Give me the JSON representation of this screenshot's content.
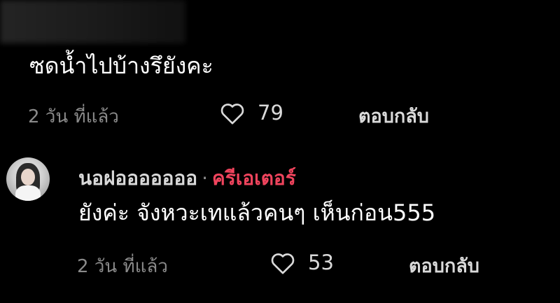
{
  "comment": {
    "text": "ซดน้ำไปบ้างรึยังคะ",
    "time": "2 วัน ที่แล้ว",
    "like_count": "79",
    "reply_label": "ตอบกลับ"
  },
  "reply": {
    "username": "นอฝอออออออ",
    "separator": "·",
    "creator_badge": "ครีเอเตอร์",
    "text": "ยังค่ะ จังหวะเทแล้วคนๆ เห็นก่อน555",
    "time": "2 วัน ที่แล้ว",
    "like_count": "53",
    "reply_label": "ตอบกลับ"
  },
  "colors": {
    "background": "#000000",
    "primary_text": "#ffffff",
    "secondary_text": "#8a8a8a",
    "creator_accent": "#f0445d"
  },
  "icons": {
    "like": "heart-outline-icon"
  }
}
